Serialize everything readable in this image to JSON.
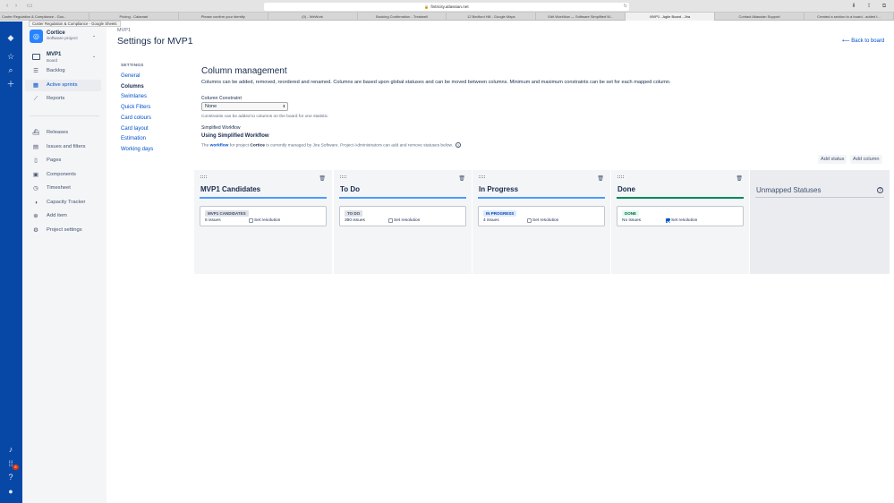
{
  "browser": {
    "url": "fintricity.atlassian.net",
    "tooltip": "Custer Regulation & Compliance - Google Sheets",
    "tabs": [
      "Custer Regulation & Compliance - Goo...",
      "Pricing - Calamari",
      "Please confirm your identity",
      "(0) - WeWork",
      "Booking Confirmation - Treatwell",
      "12 Bedford Hill - Google Maps",
      "Edit Workflow — Software Simplified W...",
      "MVP1 - Agile Board - Jira",
      "Contact Atlassian Support",
      "Created a section to a board - added t..."
    ],
    "active_tab_index": 7
  },
  "global_nav": {
    "notification_count": "6"
  },
  "sidebar": {
    "project_name": "Cortice",
    "project_type": "Software project",
    "board_name": "MVP1",
    "board_type": "Board",
    "items_top": [
      {
        "label": "Backlog",
        "icon": "backlog-icon"
      },
      {
        "label": "Active sprints",
        "icon": "active-sprints-icon"
      },
      {
        "label": "Reports",
        "icon": "reports-icon"
      }
    ],
    "items_bottom": [
      {
        "label": "Releases",
        "icon": "releases-icon"
      },
      {
        "label": "Issues and filters",
        "icon": "issues-icon"
      },
      {
        "label": "Pages",
        "icon": "pages-icon"
      },
      {
        "label": "Components",
        "icon": "components-icon"
      },
      {
        "label": "Timesheet",
        "icon": "timesheet-icon"
      },
      {
        "label": "Capacity Tracker",
        "icon": "capacity-tracker-icon"
      },
      {
        "label": "Add item",
        "icon": "add-item-icon"
      },
      {
        "label": "Project settings",
        "icon": "settings-icon"
      }
    ],
    "active_item": "Active sprints"
  },
  "header": {
    "breadcrumb": "MVP1",
    "title": "Settings for MVP1",
    "back_link": "Back to board"
  },
  "settings_nav": {
    "heading": "SETTINGS",
    "items": [
      "General",
      "Columns",
      "Swimlanes",
      "Quick Filters",
      "Card colours",
      "Card layout",
      "Estimation",
      "Working days"
    ],
    "current": "Columns"
  },
  "column_management": {
    "title": "Column management",
    "description": "Columns can be added, removed, reordered and renamed. Columns are based upon global statuses and can be moved between columns. Minimum and maximum constraints can be set for each mapped column.",
    "constraint_label": "Column Constraint",
    "constraint_value": "None",
    "constraint_help": "Constraints can be added to columns on the board for one statistic.",
    "workflow_label": "Simplified Workflow",
    "workflow_name": "Using Simplified Workflow",
    "workflow_desc_prefix": "The ",
    "workflow_link": "workflow",
    "workflow_desc_mid": " for project ",
    "workflow_project": "Cortice",
    "workflow_desc_suffix": " is currently managed by Jira Software. Project Administrators can add and remove statuses below.",
    "add_status_label": "Add status",
    "add_column_label": "Add column"
  },
  "columns": [
    {
      "name": "MVP1 Candidates",
      "status": "MVP1 CANDIDATES",
      "issues": "6 issues",
      "resolution_label": "Set resolution",
      "resolution_checked": false,
      "color": "#4C9AFF"
    },
    {
      "name": "To Do",
      "status": "TO DO",
      "issues": "390 issues",
      "resolution_label": "Set resolution",
      "resolution_checked": false,
      "color": "#4C9AFF"
    },
    {
      "name": "In Progress",
      "status": "IN PROGRESS",
      "issues": "4 issues",
      "resolution_label": "Set resolution",
      "resolution_checked": false,
      "color": "#4C9AFF"
    },
    {
      "name": "Done",
      "status": "DONE",
      "issues": "No issues",
      "resolution_label": "Set resolution",
      "resolution_checked": true,
      "color": "#00875A"
    }
  ],
  "unmapped": {
    "title": "Unmapped Statuses"
  }
}
